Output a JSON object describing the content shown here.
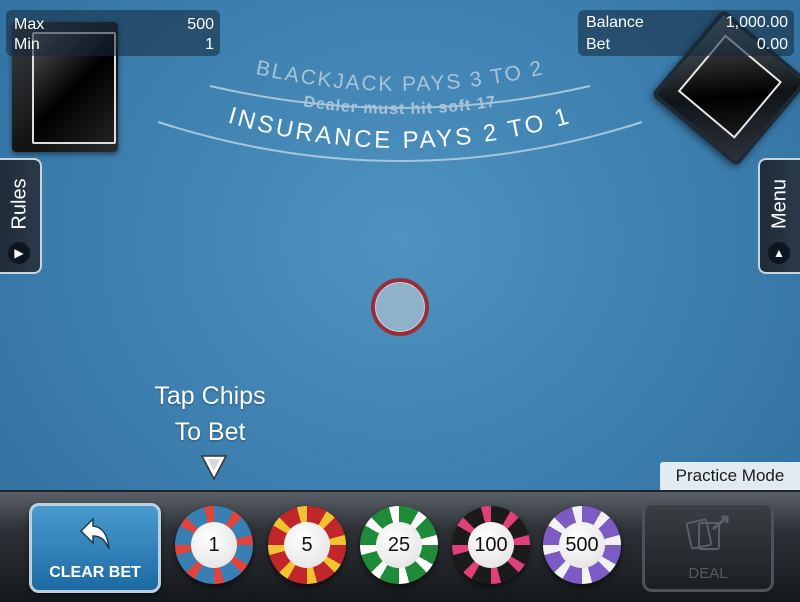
{
  "limits": {
    "max_label": "Max",
    "max_value": "500",
    "min_label": "Min",
    "min_value": "1"
  },
  "account": {
    "balance_label": "Balance",
    "balance_value": "1,000.00",
    "bet_label": "Bet",
    "bet_value": "0.00"
  },
  "table_text": {
    "line1": "BLACKJACK PAYS 3 TO 2",
    "line2": "Dealer must hit soft 17",
    "line3": "INSURANCE PAYS 2 TO 1"
  },
  "side_tabs": {
    "left_label": "Rules",
    "right_label": "Menu"
  },
  "hint": {
    "line1": "Tap Chips",
    "line2": "To Bet"
  },
  "mode_label": "Practice Mode",
  "buttons": {
    "clear_bet": "CLEAR BET",
    "deal": "DEAL"
  },
  "chips": [
    {
      "value": "1",
      "color": "#3a7fb3",
      "stripe": "#e0443c"
    },
    {
      "value": "5",
      "color": "#c0262a",
      "stripe": "#f2c230"
    },
    {
      "value": "25",
      "color": "#1f8a38",
      "stripe": "#ffffff"
    },
    {
      "value": "100",
      "color": "#1b1b1b",
      "stripe": "#e0407a"
    },
    {
      "value": "500",
      "color": "#7c5cc4",
      "stripe": "#f2f2f2"
    }
  ],
  "colors": {
    "felt": "#3f82b2",
    "bet_spot_ring": "#9a2d3a"
  }
}
